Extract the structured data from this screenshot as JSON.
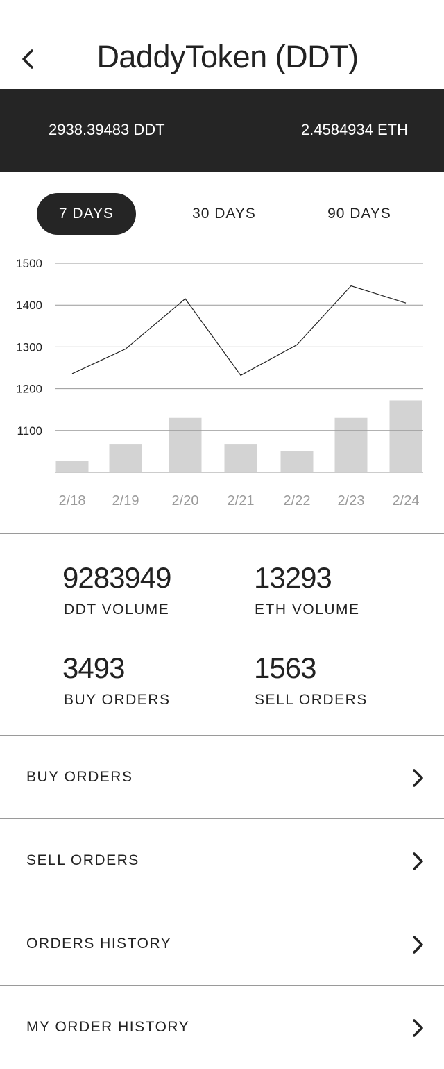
{
  "header": {
    "title": "DaddyToken (DDT)",
    "back_icon": "chevron-left-icon"
  },
  "balances": {
    "ddt": "2938.39483 DDT",
    "eth": "2.4584934 ETH"
  },
  "range_tabs": [
    {
      "label": "7 DAYS",
      "active": true
    },
    {
      "label": "30 DAYS",
      "active": false
    },
    {
      "label": "90 DAYS",
      "active": false
    }
  ],
  "chart_data": {
    "type": "line",
    "categories": [
      "2/18",
      "2/19",
      "2/20",
      "2/21",
      "2/22",
      "2/23",
      "2/24"
    ],
    "series": [
      {
        "type": "line",
        "values": [
          1236,
          1295,
          1415,
          1232,
          1305,
          1446,
          1405
        ]
      },
      {
        "type": "bar",
        "values": [
          1027,
          1068,
          1130,
          1068,
          1050,
          1130,
          1172
        ]
      }
    ],
    "y_ticks": [
      "1500",
      "1400",
      "1300",
      "1200",
      "1100"
    ],
    "ylim": [
      1000,
      1500
    ],
    "grid": true,
    "colors": {
      "line": "#222222",
      "bar": "#d3d3d3",
      "grid": "#999999",
      "tick": "#9a9a9a"
    }
  },
  "stats": [
    {
      "value": "9283949",
      "label": "DDT VOLUME"
    },
    {
      "value": "13293",
      "label": "ETH VOLUME"
    },
    {
      "value": "3493",
      "label": "BUY ORDERS"
    },
    {
      "value": "1563",
      "label": "SELL ORDERS"
    }
  ],
  "menu": [
    {
      "label": "BUY ORDERS",
      "icon": "chevron-right-icon"
    },
    {
      "label": "SELL ORDERS",
      "icon": "chevron-right-icon"
    },
    {
      "label": "ORDERS HISTORY",
      "icon": "chevron-right-icon"
    },
    {
      "label": "MY ORDER HISTORY",
      "icon": "chevron-right-icon"
    }
  ],
  "colors": {
    "dark": "#252525",
    "text": "#222222",
    "divider": "#9a9a9a"
  }
}
